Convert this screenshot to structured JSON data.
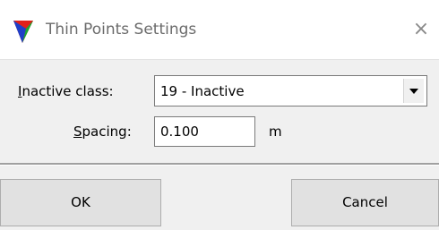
{
  "window": {
    "title": "Thin Points Settings",
    "close_glyph": "×",
    "icon": "tri-color-arrow-icon"
  },
  "form": {
    "inactive_class": {
      "label_accel": "I",
      "label_rest": "nactive class:",
      "selected": "19 - Inactive"
    },
    "spacing": {
      "label_accel": "S",
      "label_rest": "pacing:",
      "value": "0.100",
      "unit": "m"
    }
  },
  "buttons": {
    "ok": "OK",
    "cancel": "Cancel"
  },
  "colors": {
    "icon_red": "#e0201a",
    "icon_green": "#1aa832",
    "icon_blue": "#1f3fc8"
  }
}
